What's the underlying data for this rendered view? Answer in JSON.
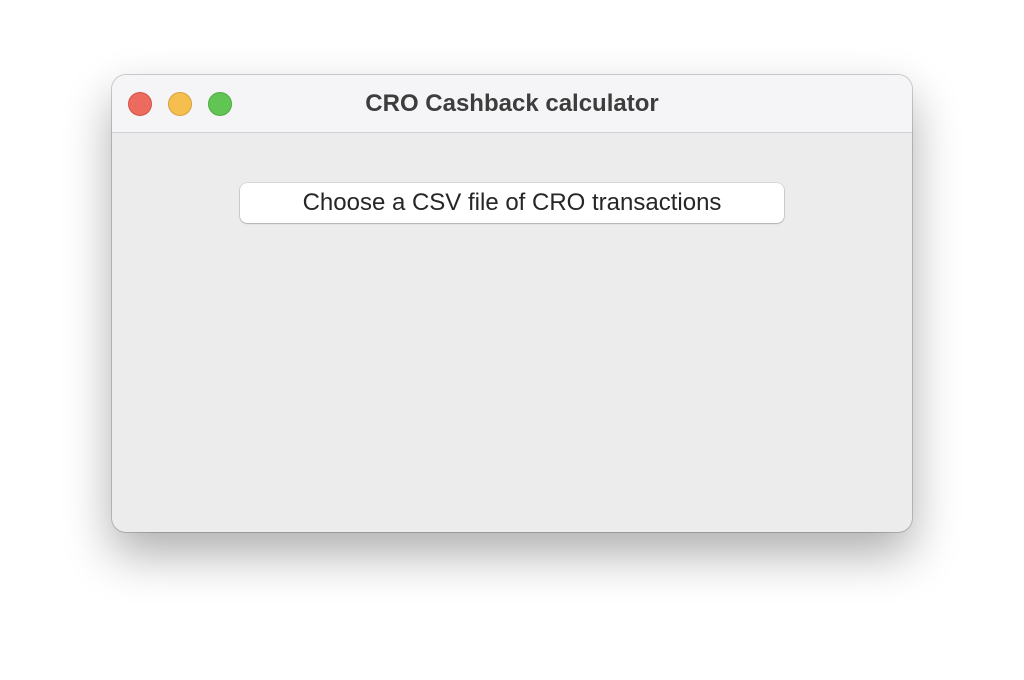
{
  "window": {
    "title": "CRO Cashback calculator",
    "controls": {
      "close_icon": "close-icon",
      "minimize_icon": "minimize-icon",
      "maximize_icon": "maximize-icon",
      "close_color": "#ed6a5e",
      "minimize_color": "#f5bf4f",
      "maximize_color": "#61c554"
    }
  },
  "main": {
    "choose_button_label": "Choose a CSV file of CRO transactions"
  }
}
